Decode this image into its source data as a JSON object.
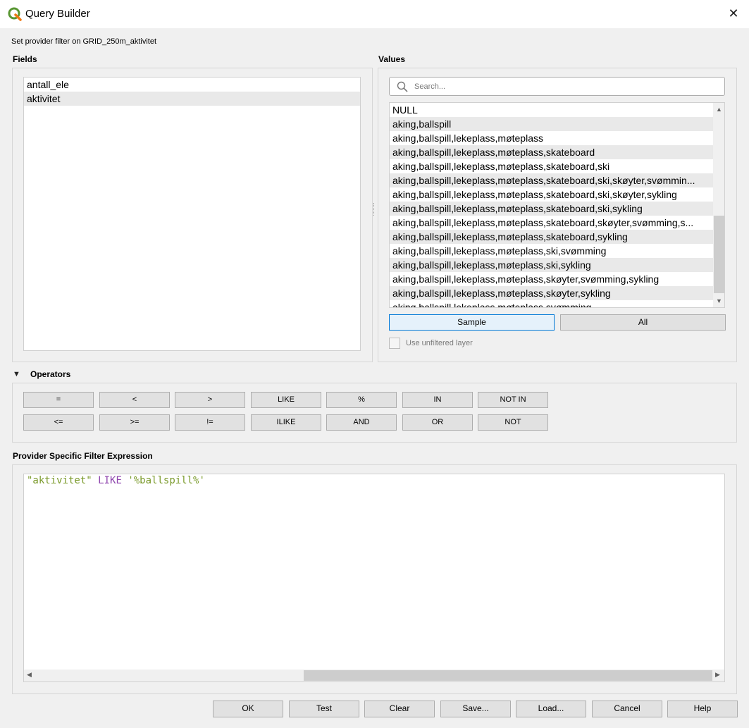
{
  "window": {
    "title": "Query Builder",
    "close_glyph": "✕"
  },
  "provider_label": "Set provider filter on GRID_250m_aktivitet",
  "fields": {
    "heading": "Fields",
    "items": [
      "antall_ele",
      "aktivitet"
    ]
  },
  "values": {
    "heading": "Values",
    "search_placeholder": "Search...",
    "items": [
      "NULL",
      "aking,ballspill",
      "aking,ballspill,lekeplass,møteplass",
      "aking,ballspill,lekeplass,møteplass,skateboard",
      "aking,ballspill,lekeplass,møteplass,skateboard,ski",
      "aking,ballspill,lekeplass,møteplass,skateboard,ski,skøyter,svømmin...",
      "aking,ballspill,lekeplass,møteplass,skateboard,ski,skøyter,sykling",
      "aking,ballspill,lekeplass,møteplass,skateboard,ski,sykling",
      "aking,ballspill,lekeplass,møteplass,skateboard,skøyter,svømming,s...",
      "aking,ballspill,lekeplass,møteplass,skateboard,sykling",
      "aking,ballspill,lekeplass,møteplass,ski,svømming",
      "aking,ballspill,lekeplass,møteplass,ski,sykling",
      "aking,ballspill,lekeplass,møteplass,skøyter,svømming,sykling",
      "aking,ballspill,lekeplass,møteplass,skøyter,sykling",
      "aking,ballspill,lekeplass,møteplass,svømming"
    ],
    "sample_label": "Sample",
    "all_label": "All",
    "unfiltered_label": "Use unfiltered layer"
  },
  "operators": {
    "heading": "Operators",
    "row1": [
      "=",
      "<",
      ">",
      "LIKE",
      "%",
      "IN",
      "NOT IN"
    ],
    "row2": [
      "<=",
      ">=",
      "!=",
      "ILIKE",
      "AND",
      "OR",
      "NOT"
    ]
  },
  "expression": {
    "heading": "Provider Specific Filter Expression",
    "field": "\"aktivitet\"",
    "keyword": "LIKE",
    "literal": "'%ballspill%'"
  },
  "footer_buttons": [
    "OK",
    "Test",
    "Clear",
    "Save...",
    "Load...",
    "Cancel",
    "Help"
  ],
  "colors": {
    "field_color": "#7a9a2a",
    "keyword_color": "#8e44ad",
    "literal_color": "#7a9a2a",
    "accent": "#0078d7"
  }
}
